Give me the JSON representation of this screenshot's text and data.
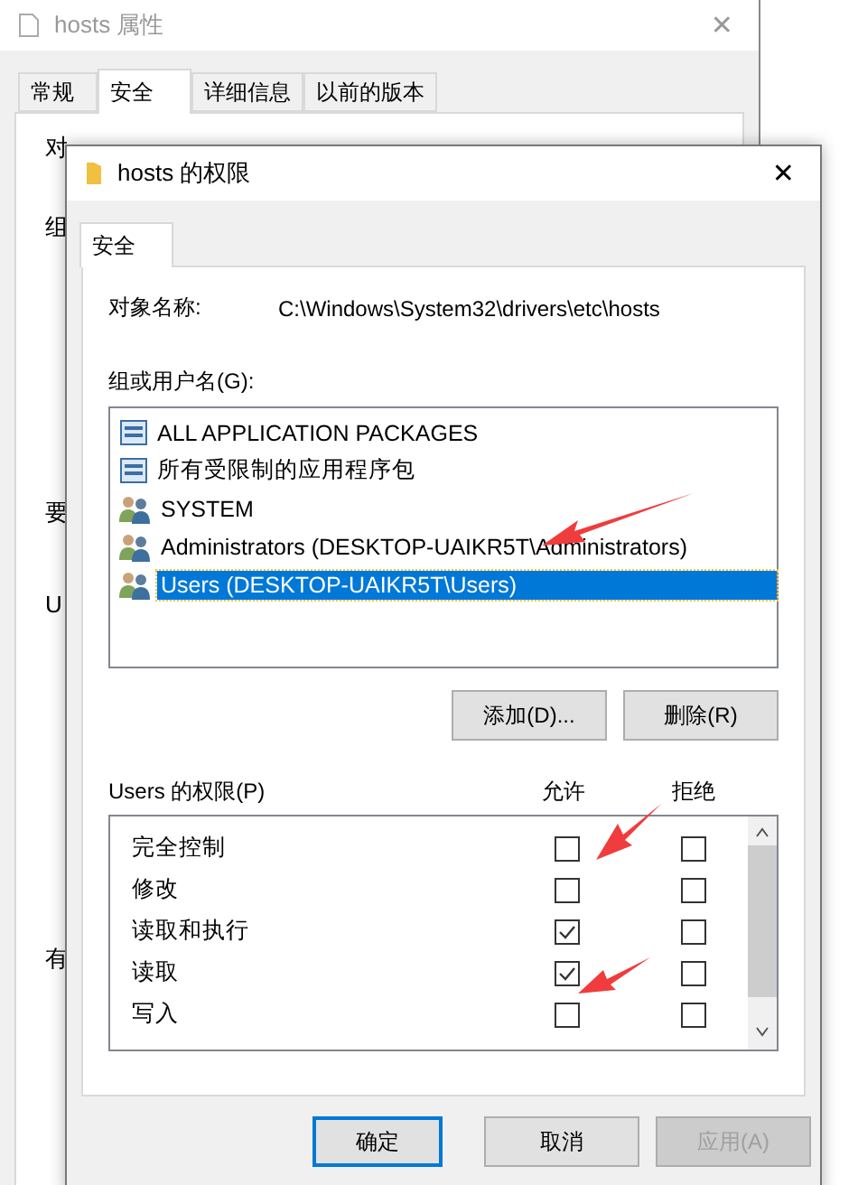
{
  "back_window": {
    "title": "hosts 属性",
    "close": "✕",
    "tabs": [
      {
        "label": "常规",
        "selected": false
      },
      {
        "label": "安全",
        "selected": true
      },
      {
        "label": "详细信息",
        "selected": false
      },
      {
        "label": "以前的版本",
        "selected": false
      }
    ],
    "cut_labels": [
      "对",
      "组",
      "要",
      "U",
      "有"
    ]
  },
  "window": {
    "title": "hosts 的权限",
    "close": "✕",
    "tabs": [
      {
        "label": "安全",
        "selected": true
      }
    ],
    "object_label": "对象名称:",
    "object_path": "C:\\Windows\\System32\\drivers\\etc\\hosts",
    "users_label": "组或用户名(G):",
    "users": [
      {
        "name": "ALL APPLICATION PACKAGES",
        "kind": "package",
        "selected": false
      },
      {
        "name": "所有受限制的应用程序包",
        "kind": "package",
        "selected": false
      },
      {
        "name": "SYSTEM",
        "kind": "group",
        "selected": false
      },
      {
        "name": "Administrators (DESKTOP-UAIKR5T\\Administrators)",
        "kind": "group",
        "selected": false
      },
      {
        "name": "Users (DESKTOP-UAIKR5T\\Users)",
        "kind": "group",
        "selected": true
      }
    ],
    "user_buttons": [
      "添加(D)...",
      "删除(R)"
    ],
    "permissions_label": "Users 的权限(P)",
    "allow_header": "允许",
    "deny_header": "拒绝",
    "permissions": [
      {
        "name": "完全控制",
        "allow": false,
        "deny": false,
        "disabled": false
      },
      {
        "name": "修改",
        "allow": false,
        "deny": false,
        "disabled": false
      },
      {
        "name": "读取和执行",
        "allow": true,
        "deny": false,
        "disabled": false
      },
      {
        "name": "读取",
        "allow": true,
        "deny": false,
        "disabled": false
      },
      {
        "name": "写入",
        "allow": false,
        "deny": false,
        "disabled": false
      }
    ],
    "buttons": [
      {
        "label": "确定",
        "default": true,
        "disabled": false
      },
      {
        "label": "取消",
        "default": false,
        "disabled": false
      },
      {
        "label": "应用(A)",
        "default": false,
        "disabled": true
      }
    ]
  }
}
